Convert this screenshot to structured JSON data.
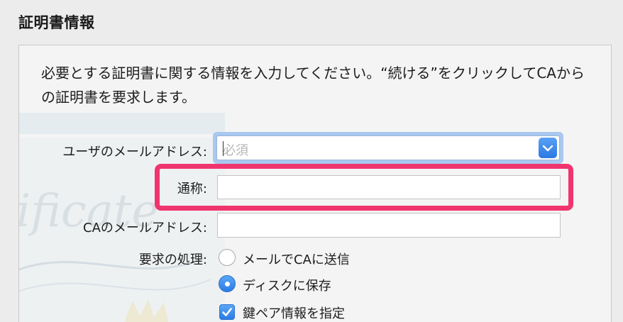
{
  "section": {
    "title": "証明書情報"
  },
  "intro": {
    "text": "必要とする証明書に関する情報を入力してください。“続ける”をクリックしてCAからの証明書を要求します。"
  },
  "form": {
    "user_email_label": "ユーザのメールアドレス:",
    "user_email_placeholder": "必須",
    "common_name_label": "通称:",
    "common_name_value": "",
    "ca_email_label": "CAのメールアドレス:",
    "ca_email_value": "",
    "request_label": "要求の処理:",
    "request_options": [
      {
        "label": "メールでCAに送信",
        "selected": false
      },
      {
        "label": "ディスクに保存",
        "selected": true
      }
    ],
    "keypair_label": "鍵ペア情報を指定",
    "keypair_checked": true
  },
  "icons": {
    "combo": "chevron-down-icon",
    "check": "checkmark-icon"
  },
  "colors": {
    "highlight": "#f0356e",
    "accent": "#2b7be5",
    "focus_ring": "#a9c8ef"
  }
}
